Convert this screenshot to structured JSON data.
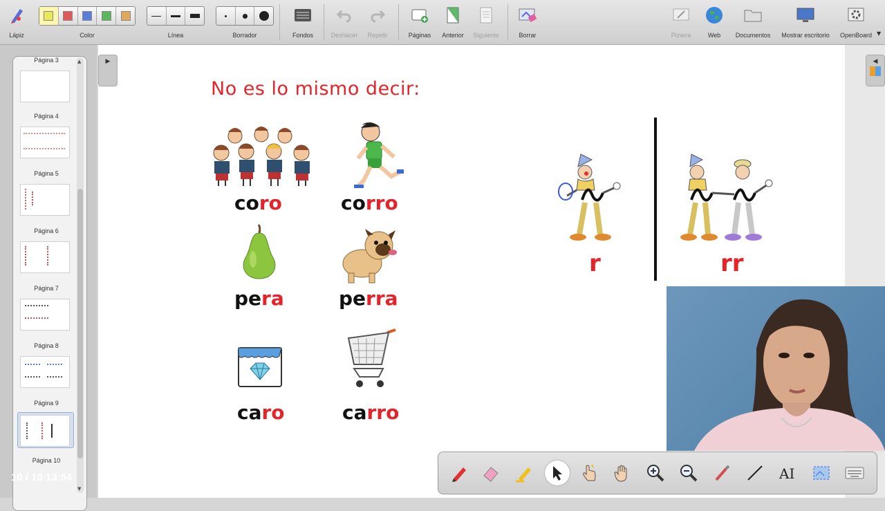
{
  "toolbar": {
    "pencil": "Lápiz",
    "color": "Color",
    "line": "Línea",
    "eraser": "Borrador",
    "backgrounds": "Fondos",
    "undo": "Deshacer",
    "redo": "Repetir",
    "pages": "Páginas",
    "previous": "Anterior",
    "next": "Siguiente",
    "clear": "Borrar",
    "board": "Pizarra",
    "web": "Web",
    "documents": "Documentos",
    "show_desktop": "Mostrar escritorio",
    "openboard": "OpenBoard",
    "colors": [
      "#e8e85a",
      "#e05a5a",
      "#5a7ed8",
      "#5ab85a",
      "#e0a85a"
    ]
  },
  "pages": {
    "items": [
      {
        "label": "Página 3"
      },
      {
        "label": "Página 4"
      },
      {
        "label": "Página 5"
      },
      {
        "label": "Página 6"
      },
      {
        "label": "Página 7"
      },
      {
        "label": "Página 8"
      },
      {
        "label": "Página 9"
      },
      {
        "label": "Página 10"
      }
    ],
    "status": "10 / 10 13:54"
  },
  "slide": {
    "title": "No es lo mismo decir:",
    "words": [
      {
        "base": "co",
        "accent": "ro"
      },
      {
        "base": "co",
        "accent": "rro"
      },
      {
        "base": "pe",
        "accent": "ra"
      },
      {
        "base": "pe",
        "accent": "rra"
      },
      {
        "base": "ca",
        "accent": "ro"
      },
      {
        "base": "ca",
        "accent": "rro"
      }
    ],
    "letter_single": "r",
    "letter_double": "rr"
  },
  "colors": {
    "accent_red": "#e3242b"
  }
}
